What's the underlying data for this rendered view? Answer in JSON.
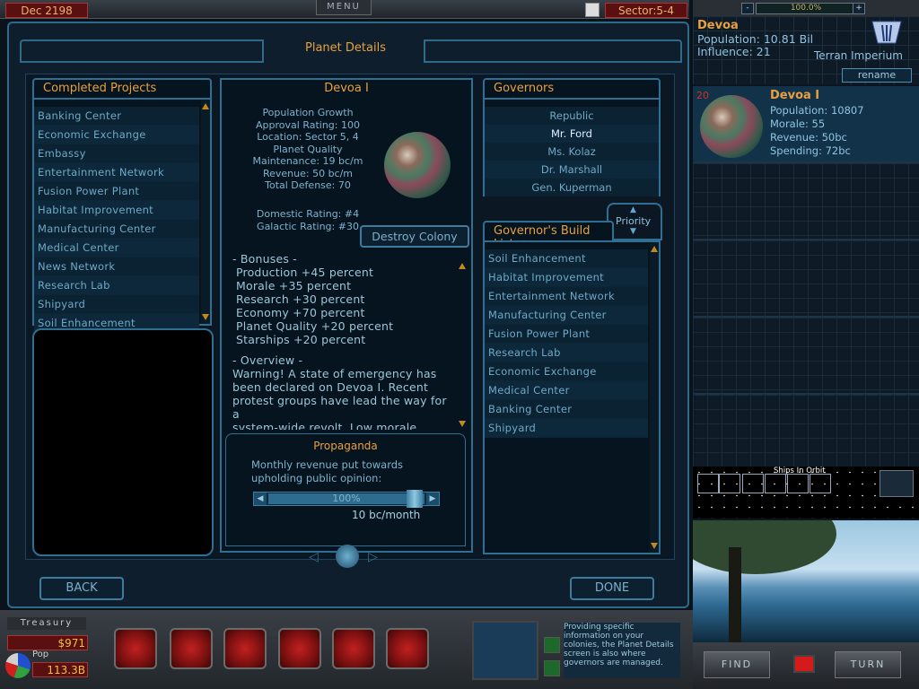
{
  "topbar": {
    "date": "Dec 2198",
    "menu_label": "MENU",
    "sector": "Sector:5-4"
  },
  "main": {
    "title": "Planet Details",
    "completed_header": "Completed Projects",
    "completed_projects": [
      "Banking Center",
      "Economic Exchange",
      "Embassy",
      "Entertainment Network",
      "Fusion Power Plant",
      "Habitat Improvement",
      "Manufacturing Center",
      "Medical Center",
      "News Network",
      "Research Lab",
      "Shipyard",
      "Soil Enhancement"
    ],
    "planet_name": "Devoa I",
    "stats": [
      "Population Growth",
      "Approval Rating: 100",
      "Location: Sector 5, 4",
      "Planet Quality",
      "Maintenance: 19 bc/m",
      "Revenue: 50 bc/m",
      "Total Defense: 70"
    ],
    "ratings": [
      "Domestic Rating: #4",
      "Galactic Rating: #30"
    ],
    "destroy_label": "Destroy Colony",
    "bonuses_header": "- Bonuses -",
    "bonuses": [
      "Production  +45 percent",
      "Morale  +35 percent",
      "Research  +30 percent",
      "Economy  +70 percent",
      "Planet Quality  +20 percent",
      "Starships  +20 percent"
    ],
    "overview_header": "- Overview -",
    "overview_lines": [
      "Warning! A state of emergency has",
      "been declared on Devoa I. Recent",
      "protest groups have lead the way for a",
      "system-wide revolt. Low morale"
    ],
    "propaganda_title": "Propaganda",
    "propaganda_desc_1": "Monthly revenue put towards",
    "propaganda_desc_2": "upholding public opinion:",
    "propaganda_percent": "100%",
    "propaganda_level": 1.0,
    "propaganda_amount": "10  bc/month",
    "governors_header": "Governors",
    "governors": [
      "Republic",
      "Mr. Ford",
      "Ms. Kolaz",
      "Dr. Marshall",
      "Gen. Kuperman"
    ],
    "priority_label": "Priority",
    "build_header": "Governor's Build List",
    "build_list": [
      "Soil Enhancement",
      "Habitat Improvement",
      "Entertainment Network",
      "Manufacturing Center",
      "Fusion Power Plant",
      "Research Lab",
      "Economic Exchange",
      "Medical Center",
      "Banking Center",
      "Shipyard"
    ],
    "back_label": "BACK",
    "done_label": "DONE"
  },
  "right": {
    "zoom": "100.0%",
    "zoom_minus": "-",
    "zoom_plus": "+",
    "system_name": "Devoa",
    "population": "Population: 10.81 Bil",
    "influence": "Influence: 21",
    "empire": "Terran  Imperium",
    "rename_label": "rename",
    "planet_number": "20",
    "planet_name": "Devoa I",
    "planet_population": "Population: 10807",
    "planet_morale": "Morale: 55",
    "planet_revenue": "Revenue: 50bc",
    "planet_spending": "Spending: 72bc",
    "ships_label": "Ships  In  Orbit",
    "find_label": "FIND",
    "turn_label": "TURN"
  },
  "bottom": {
    "treasury_label": "Treasury",
    "treasury_value": "$971",
    "pop_label": "Pop",
    "pop_value": "113.3B",
    "help_text": "Providing specific information on your colonies, the Planet Details screen is also where governors are managed."
  }
}
